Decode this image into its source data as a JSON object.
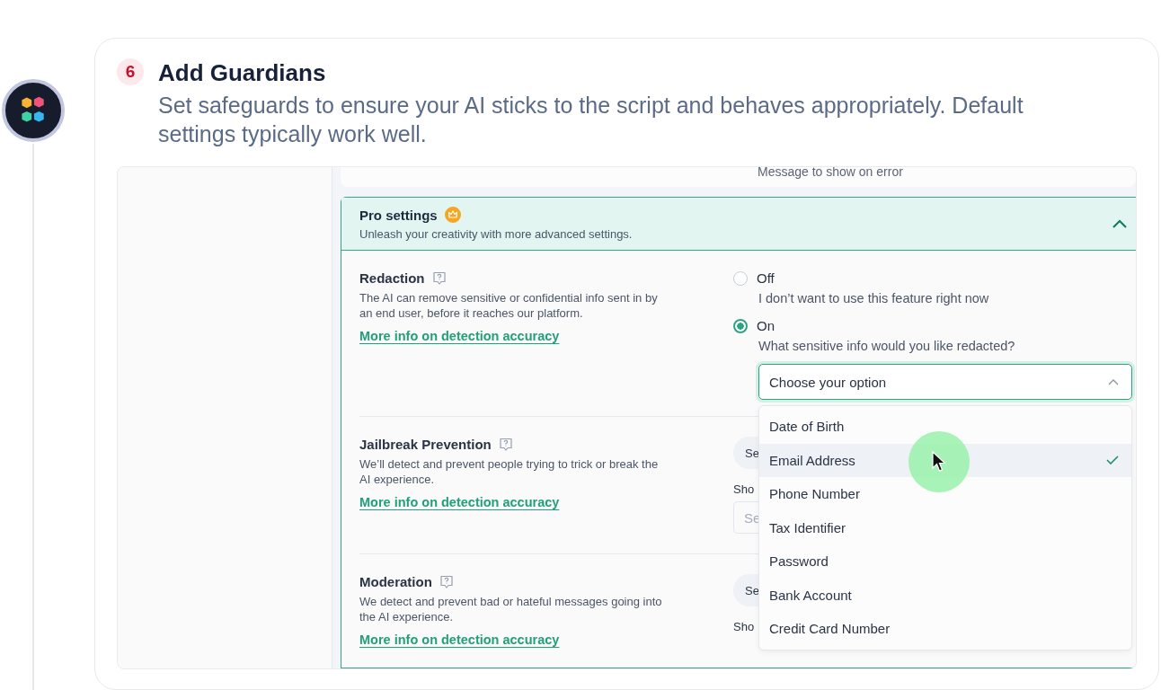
{
  "step": {
    "number": "6",
    "title": "Add Guardians",
    "subtitle": "Set safeguards to ensure your AI sticks to the script and behaves appropriately. Default settings typically work well."
  },
  "error_message_label": "Message to show on error",
  "pro_settings": {
    "title": "Pro settings",
    "subtitle": "Unleash your creativity with more advanced settings.",
    "expanded": true
  },
  "redaction": {
    "title": "Redaction",
    "description": "The AI can remove sensitive or confidential info sent in by an end user, before it reaches our platform.",
    "link": "More info on detection accuracy",
    "options": [
      {
        "label": "Off",
        "description": "I don’t want to use this feature right now",
        "selected": false
      },
      {
        "label": "On",
        "description": "What sensitive info would you like redacted?",
        "selected": true
      }
    ],
    "select": {
      "placeholder": "Choose your option",
      "expanded": true,
      "items": [
        {
          "label": "Date of Birth",
          "selected": false
        },
        {
          "label": "Email Address",
          "selected": true
        },
        {
          "label": "Phone Number",
          "selected": false
        },
        {
          "label": "Tax Identifier",
          "selected": false
        },
        {
          "label": "Password",
          "selected": false
        },
        {
          "label": "Bank Account",
          "selected": false
        },
        {
          "label": "Credit Card Number",
          "selected": false
        }
      ]
    }
  },
  "guards": [
    {
      "title": "Jailbreak Prevention",
      "description": "We’ll detect and prevent people trying to trick or break the AI experience.",
      "link": "More info on detection accuracy",
      "button": "Se",
      "show_label": "Sho",
      "field_placeholder": "Se"
    },
    {
      "title": "Moderation",
      "description": "We detect and prevent bad or hateful messages going into the AI experience.",
      "link": "More info on detection accuracy",
      "button": "Se",
      "show_label": "Sho"
    }
  ]
}
